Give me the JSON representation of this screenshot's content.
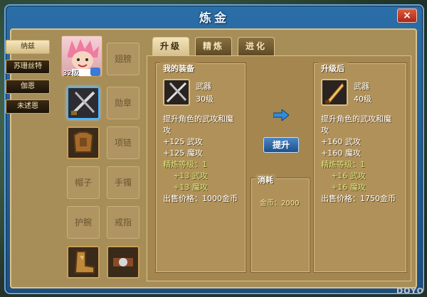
{
  "window": {
    "title": "炼金",
    "close_label": "×"
  },
  "side_tabs": [
    {
      "label": "纳兹",
      "active": true
    },
    {
      "label": "苏珊丝特",
      "active": false
    },
    {
      "label": "伽恩",
      "active": false
    },
    {
      "label": "未述恩",
      "active": false
    }
  ],
  "character": {
    "level": "32级"
  },
  "equip_slots": {
    "wings": "翅膀",
    "medal": "勋章",
    "necklace": "项链",
    "hat": "帽子",
    "bracelet": "手镯",
    "wristguard": "护腕",
    "ring": "戒指"
  },
  "tabs": [
    {
      "label": "升级",
      "active": true
    },
    {
      "label": "精炼",
      "active": false
    },
    {
      "label": "进化",
      "active": false
    }
  ],
  "my_equip": {
    "title": "我的装备",
    "name": "武器",
    "level": "30级",
    "desc_line1": "提升角色的武攻和魔",
    "desc_line2": "攻",
    "stat1": "+125 武攻",
    "stat2": "+125 魔攻",
    "refine_label": "精炼等级：1",
    "refine_stat1": "+13 武攻",
    "refine_stat2": "+13 魔攻",
    "price": "出售价格：1000金币"
  },
  "after_upgrade": {
    "title": "升级后",
    "name": "武器",
    "level": "40级",
    "desc_line1": "提升角色的武攻和魔",
    "desc_line2": "攻",
    "stat1": "+160 武攻",
    "stat2": "+160 魔攻",
    "refine_label": "精炼等级：1",
    "refine_stat1": "+16 武攻",
    "refine_stat2": "+16 魔攻",
    "price": "出售价格：1750金币"
  },
  "actions": {
    "upgrade_label": "提升"
  },
  "cost": {
    "title": "消耗",
    "value": "金币：2000"
  },
  "watermark": "DOYO",
  "colors": {
    "window_blue": "#2a6ea8",
    "panel_tan": "#b0915a",
    "highlight_green": "#d8e67a",
    "button_blue": "#1f4f8a"
  }
}
